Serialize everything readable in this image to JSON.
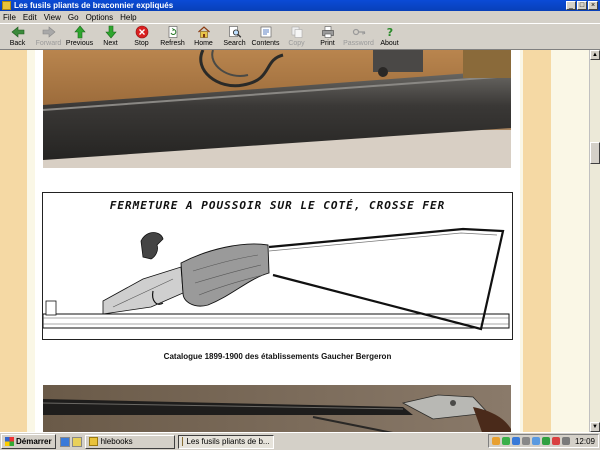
{
  "window": {
    "title": "Les fusils pliants de braconnier expliqués",
    "controls": [
      "_",
      "□",
      "×"
    ]
  },
  "menu": [
    "File",
    "Edit",
    "View",
    "Go",
    "Options",
    "Help"
  ],
  "toolbar": [
    {
      "label": "Back",
      "icon": "back-icon",
      "enabled": true
    },
    {
      "label": "Forward",
      "icon": "forward-icon",
      "enabled": false
    },
    {
      "label": "Previous",
      "icon": "previous-icon",
      "enabled": true
    },
    {
      "label": "Next",
      "icon": "next-icon",
      "enabled": true
    },
    {
      "label": "Stop",
      "icon": "stop-icon",
      "enabled": true
    },
    {
      "label": "Refresh",
      "icon": "refresh-icon",
      "enabled": true
    },
    {
      "label": "Home",
      "icon": "home-icon",
      "enabled": true
    },
    {
      "label": "Search",
      "icon": "search-icon",
      "enabled": true
    },
    {
      "label": "Contents",
      "icon": "contents-icon",
      "enabled": true
    },
    {
      "label": "Copy",
      "icon": "copy-icon",
      "enabled": false
    },
    {
      "label": "Print",
      "icon": "print-icon",
      "enabled": true
    },
    {
      "label": "Password",
      "icon": "password-icon",
      "enabled": false
    },
    {
      "label": "About",
      "icon": "about-icon",
      "enabled": true
    }
  ],
  "content": {
    "engraving_title": "FERMETURE A POUSSOIR SUR LE COTÉ, CROSSE FER",
    "caption": "Catalogue 1899-1900 des établissements Gaucher Bergeron"
  },
  "taskbar": {
    "start_label": "Démarrer",
    "tasks": [
      {
        "label": "hlebooks",
        "active": false
      },
      {
        "label": "Les fusils pliants de b...",
        "active": true
      }
    ],
    "clock": "12:09"
  },
  "colors": {
    "title_bar": "#0a4bd6",
    "page_margin": "#f5d9a4",
    "page_bg": "#faf7e6",
    "chrome": "#d4d0c8"
  }
}
